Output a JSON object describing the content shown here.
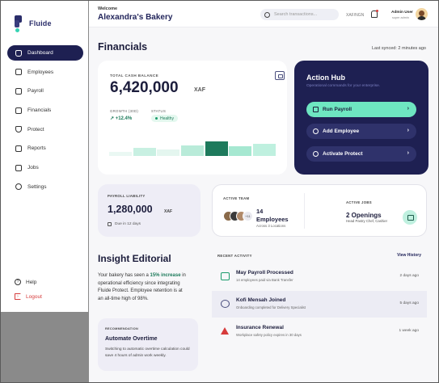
{
  "brand": {
    "name": "Fluide"
  },
  "sidebar": {
    "items": [
      {
        "label": "Dashboard",
        "icon": "home-icon",
        "active": true
      },
      {
        "label": "Employees",
        "icon": "users-icon"
      },
      {
        "label": "Payroll",
        "icon": "payroll-icon"
      },
      {
        "label": "Financials",
        "icon": "financials-icon"
      },
      {
        "label": "Protect",
        "icon": "shield-icon"
      },
      {
        "label": "Reports",
        "icon": "reports-icon"
      },
      {
        "label": "Jobs",
        "icon": "jobs-icon"
      },
      {
        "label": "Settings",
        "icon": "gear-icon"
      }
    ],
    "bottom": [
      {
        "label": "Help",
        "icon": "help-icon"
      },
      {
        "label": "Logout",
        "icon": "logout-icon"
      }
    ]
  },
  "header": {
    "welcome": "Welcome",
    "org_name": "Alexandra's Bakery",
    "search_placeholder": "Search transactions...",
    "currency": "XAF/NGN",
    "admin_name": "Admin User",
    "admin_role": "super admin"
  },
  "financials": {
    "title": "Financials",
    "last_synced": "Last synced: 2 minutes ago",
    "cash_label": "TOTAL CASH BALANCE",
    "cash_value": "6,420,000",
    "cash_currency": "XAF",
    "growth_label": "GROWTH (30D)",
    "growth_value": "+12.4%",
    "status_label": "STATUS",
    "status_value": "Healthy",
    "bar_heights": [
      0.25,
      0.45,
      0.35,
      0.6,
      0.8,
      0.55,
      0.7
    ],
    "bar_colors": [
      "#eaf8f3",
      "#c8f0e2",
      "#e4f6ef",
      "#b9ebd9",
      "#1e7a5c",
      "#a6e8d1",
      "#bff0df"
    ]
  },
  "action_hub": {
    "title": "Action Hub",
    "subtitle": "Operational commands for your enterprise.",
    "buttons": [
      {
        "label": "Run Payroll",
        "icon": "payroll-icon"
      },
      {
        "label": "Add Employee",
        "icon": "add-user-icon"
      },
      {
        "label": "Activate Protect",
        "icon": "shield-icon"
      }
    ]
  },
  "payroll": {
    "label": "PAYROLL LIABILITY",
    "value": "1,280,000",
    "currency": "XAF",
    "due": "Due in 12 days"
  },
  "team": {
    "label": "ACTIVE TEAM",
    "more": "+11",
    "count": "14",
    "word": "Employees",
    "locations": "Across 3 Locations",
    "jobs_label": "ACTIVE JOBS",
    "jobs_value": "2 Openings",
    "jobs_sub": "Head Pastry Chef, Cashier"
  },
  "insight": {
    "title": "Insight Editorial",
    "body_pre": "Your bakery has seen a ",
    "body_highlight": "15% increase",
    "body_post": " in operational efficiency since integrating Fluide Protect. Employee retention is at an all-time high of 98%.",
    "rec_label": "RECOMMENDATION",
    "rec_title": "Automate Overtime",
    "rec_body": "Switching to automatic overtime calculation could save 4 hours of admin work weekly."
  },
  "activity": {
    "label": "RECENT ACTIVITY",
    "view_history": "View History",
    "rows": [
      {
        "title": "May Payroll Processed",
        "sub": "14 employees paid via Bank Transfer",
        "time": "2 days ago",
        "icon": "payroll-icon",
        "icon_color": "#1c9c6c"
      },
      {
        "title": "Kofi Mensah Joined",
        "sub": "Onboarding completed for Delivery Specialist",
        "time": "5 days ago",
        "icon": "add-user-icon",
        "icon_color": "#4b4f7e"
      },
      {
        "title": "Insurance Renewal",
        "sub": "Workplace safety policy expires in 30 days",
        "time": "1 week ago",
        "icon": "warning-icon",
        "icon_color": "#d63b3b"
      }
    ]
  }
}
